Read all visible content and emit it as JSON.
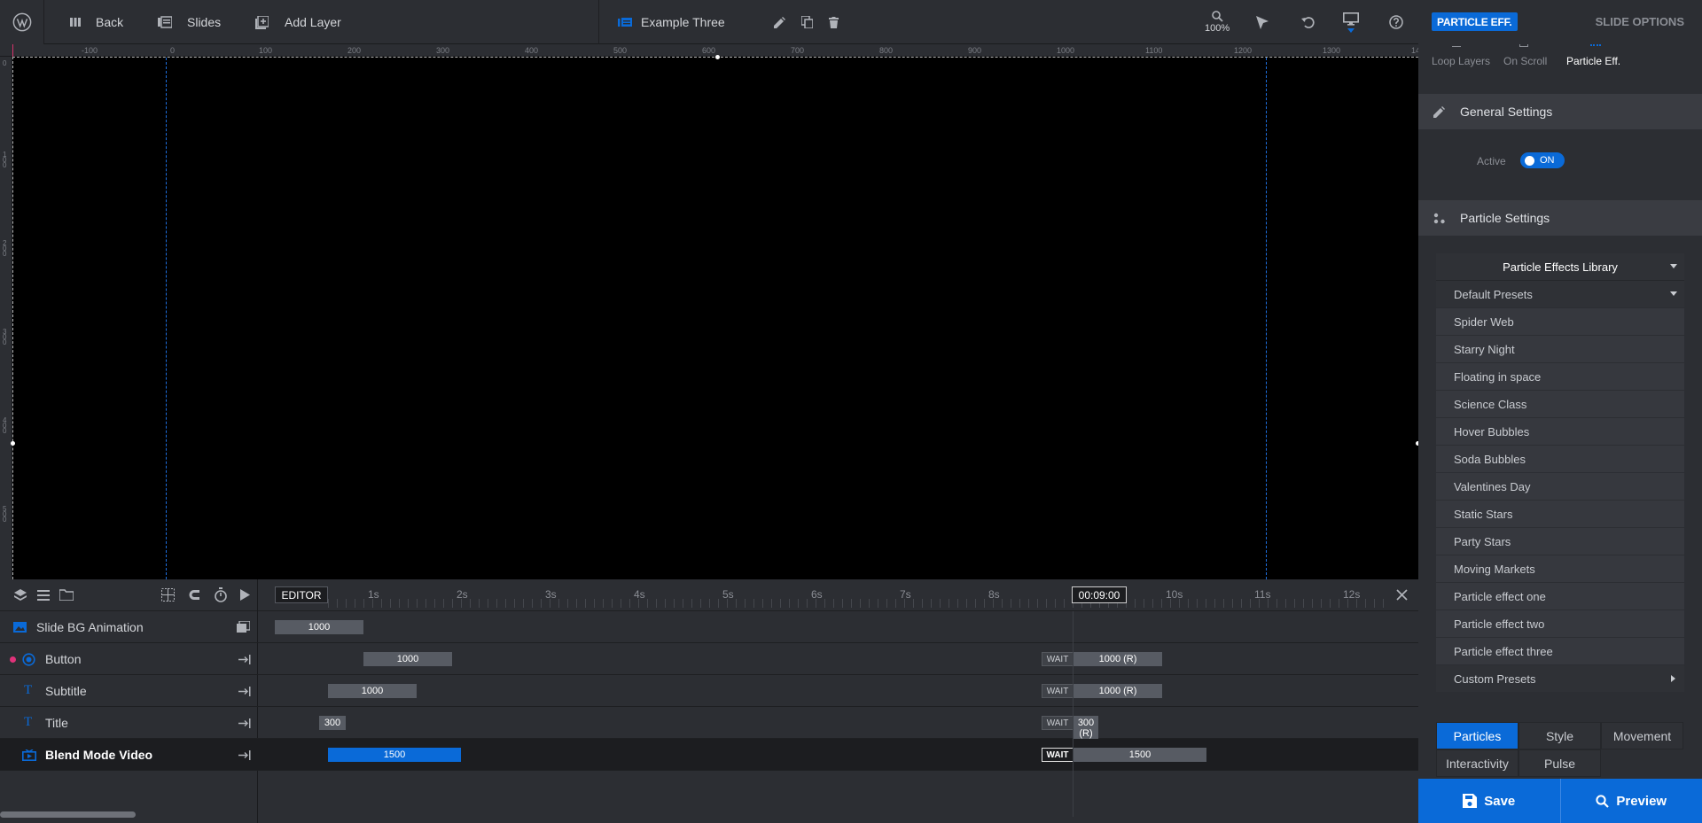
{
  "topbar": {
    "back_label": "Back",
    "slides_label": "Slides",
    "add_layer_label": "Add Layer",
    "slide_name": "Example Three",
    "zoom": "100%"
  },
  "ruler": {
    "top_ticks": [
      "-100",
      "0",
      "100",
      "200",
      "300",
      "400",
      "500",
      "600",
      "700",
      "800",
      "900",
      "1000",
      "1100",
      "1200",
      "1300",
      "14"
    ],
    "left_ticks": [
      "0",
      "100",
      "200",
      "300",
      "400",
      "500"
    ]
  },
  "timeline": {
    "editor_label": "EDITOR",
    "time": "00:09:00",
    "seconds": [
      "1s",
      "2s",
      "3s",
      "4s",
      "5s",
      "6s",
      "7s",
      "8s",
      "10s",
      "11s",
      "12s"
    ],
    "wait_label": "WAIT",
    "rows": [
      {
        "name": "Slide BG Animation",
        "bar": "1000"
      },
      {
        "name": "Button",
        "bar": "1000",
        "end": "1000 (R)"
      },
      {
        "name": "Subtitle",
        "bar": "1000",
        "end": "1000 (R)"
      },
      {
        "name": "Title",
        "bar": "300",
        "end": "300 (R)"
      },
      {
        "name": "Blend Mode Video",
        "bar": "1500",
        "end": "1500"
      }
    ]
  },
  "panel": {
    "badge": "PARTICLE EFF.",
    "slide_options": "SLIDE OPTIONS",
    "sub_tabs": [
      "Loop Layers",
      "On Scroll",
      "Particle Eff."
    ],
    "general_settings": "General Settings",
    "active_label": "Active",
    "toggle_label": "ON",
    "particle_settings": "Particle Settings",
    "library_title": "Particle Effects Library",
    "default_presets": "Default Presets",
    "presets": [
      "Spider Web",
      "Starry Night",
      "Floating in space",
      "Science Class",
      "Hover Bubbles",
      "Soda Bubbles",
      "Valentines Day",
      "Static Stars",
      "Party Stars",
      "Moving Markets",
      "Particle effect one",
      "Particle effect two",
      "Particle effect three"
    ],
    "custom_presets": "Custom Presets",
    "tabs": [
      "Particles",
      "Style",
      "Movement",
      "Interactivity",
      "Pulse"
    ],
    "save_label": "Save",
    "preview_label": "Preview"
  },
  "colors": {
    "accent": "#0a6ad8",
    "background": "#2c2e33",
    "canvas": "#000000"
  }
}
